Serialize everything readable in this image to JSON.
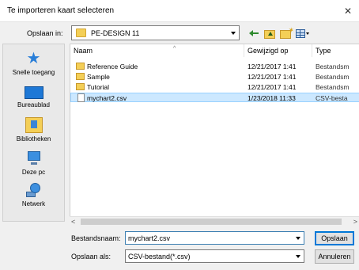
{
  "window": {
    "title": "Te importeren kaart selecteren",
    "close_glyph": "✕"
  },
  "lookin": {
    "label": "Opslaan in:",
    "value": "PE-DESIGN 11"
  },
  "places": [
    {
      "label": "Snelle toegang",
      "icon": "quick-access-icon"
    },
    {
      "label": "Bureaublad",
      "icon": "desktop-icon"
    },
    {
      "label": "Bibliotheken",
      "icon": "libraries-icon"
    },
    {
      "label": "Deze pc",
      "icon": "this-pc-icon"
    },
    {
      "label": "Netwerk",
      "icon": "network-icon"
    }
  ],
  "columns": {
    "name": "Naam",
    "modified": "Gewijzigd op",
    "type": "Type"
  },
  "files": [
    {
      "name": "Reference Guide",
      "modified": "12/21/2017 1:41",
      "type": "Bestandsm",
      "kind": "folder"
    },
    {
      "name": "Sample",
      "modified": "12/21/2017 1:41",
      "type": "Bestandsm",
      "kind": "folder"
    },
    {
      "name": "Tutorial",
      "modified": "12/21/2017 1:41",
      "type": "Bestandsm",
      "kind": "folder"
    },
    {
      "name": "mychart2.csv",
      "modified": "1/23/2018 11:33",
      "type": "CSV-besta",
      "kind": "file",
      "selected": true
    }
  ],
  "filename": {
    "label": "Bestandsnaam:",
    "value": "mychart2.csv"
  },
  "filetype": {
    "label": "Opslaan als:",
    "value": "CSV-bestand(*.csv)"
  },
  "buttons": {
    "save": "Opslaan",
    "cancel": "Annuleren"
  },
  "scroll": {
    "left": "<",
    "right": ">"
  },
  "colors": {
    "selection": "#cce8ff",
    "folder": "#f4cf57",
    "accent": "#0078d7"
  }
}
